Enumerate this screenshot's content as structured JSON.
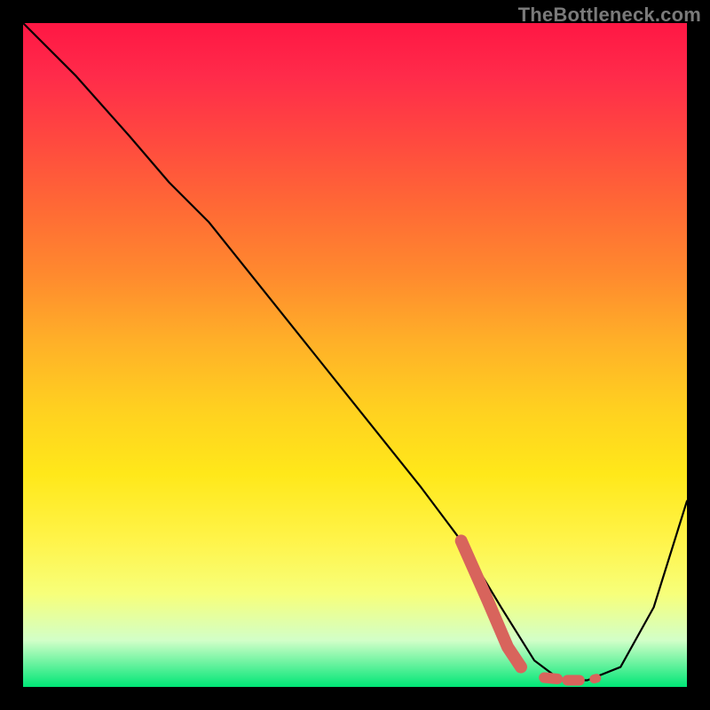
{
  "watermark": "TheBottleneck.com",
  "chart_data": {
    "type": "line",
    "title": "",
    "xlabel": "",
    "ylabel": "",
    "xlim": [
      0,
      100
    ],
    "ylim": [
      0,
      100
    ],
    "grid": false,
    "legend": false,
    "series": [
      {
        "name": "main-curve",
        "x": [
          0,
          8,
          16,
          22,
          28,
          36,
          44,
          52,
          60,
          66,
          72,
          77,
          81,
          85,
          90,
          95,
          100
        ],
        "y": [
          100,
          92,
          83,
          76,
          70,
          60,
          50,
          40,
          30,
          22,
          12,
          4,
          1,
          1,
          3,
          12,
          28
        ],
        "stroke": "#000000",
        "width": 2.2
      },
      {
        "name": "salmon-thick-segment",
        "x": [
          66,
          70,
          73,
          75
        ],
        "y": [
          22,
          13,
          6,
          3
        ],
        "stroke": "#d8645c",
        "width": 14
      },
      {
        "name": "salmon-dash-point-a",
        "x": [
          78.5,
          80.5
        ],
        "y": [
          1.4,
          1.2
        ],
        "stroke": "#d8645c",
        "width": 12
      },
      {
        "name": "salmon-dash-point-b",
        "x": [
          82.0,
          83.8
        ],
        "y": [
          1.0,
          1.0
        ],
        "stroke": "#d8645c",
        "width": 12
      },
      {
        "name": "salmon-dash-point-c",
        "x": [
          86.0,
          86.4
        ],
        "y": [
          1.2,
          1.3
        ],
        "stroke": "#d8645c",
        "width": 10
      }
    ]
  }
}
